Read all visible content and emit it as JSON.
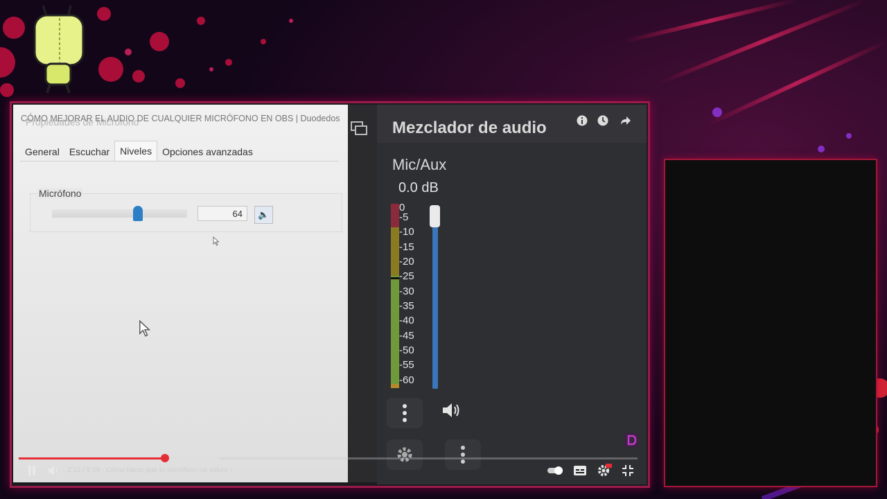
{
  "video": {
    "title": "CÓMO MEJORAR EL AUDIO DE CUALQUIER MICRÓFONO EN OBS | Duodedos",
    "dialog_title": "Propiedades de Micrófono",
    "current_time": "2:12",
    "duration": "9:29",
    "chapter": "· Cómo hacer que tu micrófono no sature",
    "progress": 0.232
  },
  "properties": {
    "tabs": [
      {
        "label": "General"
      },
      {
        "label": "Escuchar"
      },
      {
        "label": "Niveles",
        "active": true
      },
      {
        "label": "Opciones avanzadas"
      }
    ],
    "group_label": "Micrófono",
    "level_value": "64",
    "slider_level": 0.64
  },
  "mixer": {
    "title": "Mezclador de audio",
    "channel": "Mic/Aux",
    "db": "0.0 dB",
    "scale": [
      "0",
      "-5",
      "-10",
      "-15",
      "-20",
      "-25",
      "-30",
      "-35",
      "-40",
      "-45",
      "-50",
      "-55",
      "-60"
    ],
    "header_icons": [
      "info-icon",
      "clock-icon",
      "share-icon"
    ]
  },
  "colors": {
    "accent_red": "#e52d36",
    "fader_blue": "#3b76b8",
    "frame_border": "#9a1a4a"
  }
}
